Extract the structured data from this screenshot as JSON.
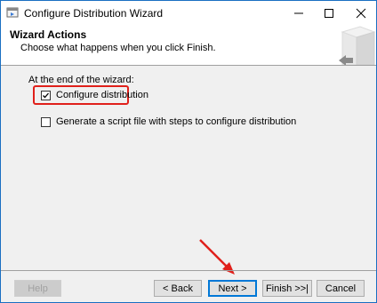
{
  "window": {
    "title": "Configure Distribution Wizard"
  },
  "header": {
    "title": "Wizard Actions",
    "subtitle": "Choose what happens when you click Finish."
  },
  "main": {
    "section_label": "At the end of the wizard:",
    "options": [
      {
        "label": "Configure distribution",
        "checked": true
      },
      {
        "label": "Generate a script file with steps to configure distribution",
        "checked": false
      }
    ]
  },
  "buttons": {
    "help": "Help",
    "back": "< Back",
    "next": "Next >",
    "finish": "Finish >>|",
    "cancel": "Cancel"
  },
  "colors": {
    "annotation": "#e0201b",
    "focus": "#0078d7",
    "window_border": "#1a6fc2"
  }
}
